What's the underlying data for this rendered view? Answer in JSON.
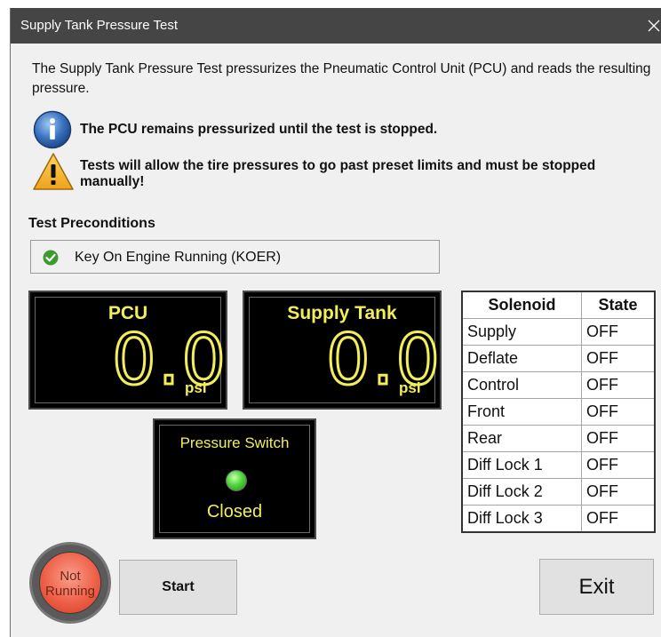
{
  "window": {
    "title": "Supply Tank Pressure Test"
  },
  "intro": "The Supply Tank Pressure Test pressurizes the Pneumatic Control Unit (PCU) and reads the resulting pressure.",
  "info_message": "The PCU remains pressurized until the test is stopped.",
  "warning_message": "Tests will allow the tire pressures to go past preset limits and must be stopped manually!",
  "preconditions": {
    "heading": "Test Preconditions",
    "items": [
      {
        "label": "Key On Engine Running (KOER)",
        "status": "met",
        "icon": "check-icon"
      }
    ]
  },
  "gauges": [
    {
      "label": "PCU",
      "value": "0.0",
      "unit": "psi"
    },
    {
      "label": "Supply Tank",
      "value": "0.0",
      "unit": "psi"
    }
  ],
  "pressure_switch": {
    "label": "Pressure Switch",
    "state": "Closed",
    "led_color": "#4fd63a"
  },
  "solenoid_table": {
    "headers": [
      "Solenoid",
      "State"
    ],
    "rows": [
      [
        "Supply",
        "OFF"
      ],
      [
        "Deflate",
        "OFF"
      ],
      [
        "Control",
        "OFF"
      ],
      [
        "Front",
        "OFF"
      ],
      [
        "Rear",
        "OFF"
      ],
      [
        "Diff Lock 1",
        "OFF"
      ],
      [
        "Diff Lock 2",
        "OFF"
      ],
      [
        "Diff Lock 3",
        "OFF"
      ]
    ]
  },
  "status_indicator": {
    "line1": "Not",
    "line2": "Running",
    "color": "#ef6048"
  },
  "buttons": {
    "start": "Start",
    "exit": "Exit"
  },
  "colors": {
    "display_text": "#f2ee59",
    "titlebar": "#454545",
    "window_bg": "#f0f0f0"
  }
}
